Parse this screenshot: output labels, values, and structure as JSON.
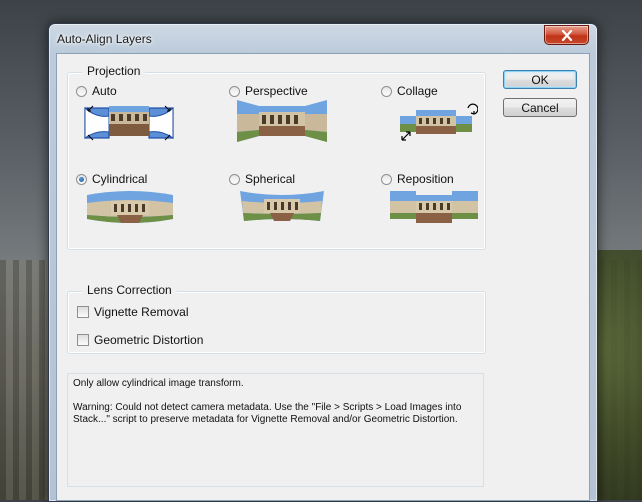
{
  "window": {
    "title": "Auto-Align Layers"
  },
  "projection": {
    "legend": "Projection",
    "options": [
      {
        "label": "Auto",
        "checked": false
      },
      {
        "label": "Perspective",
        "checked": false
      },
      {
        "label": "Collage",
        "checked": false
      },
      {
        "label": "Cylindrical",
        "checked": true
      },
      {
        "label": "Spherical",
        "checked": false
      },
      {
        "label": "Reposition",
        "checked": false
      }
    ]
  },
  "lens_correction": {
    "legend": "Lens Correction",
    "options": [
      {
        "label": "Vignette Removal",
        "checked": false
      },
      {
        "label": "Geometric Distortion",
        "checked": false
      }
    ]
  },
  "buttons": {
    "ok": "OK",
    "cancel": "Cancel"
  },
  "info": {
    "line1": "Only allow cylindrical image transform.",
    "line2": "Warning: Could not detect camera metadata. Use the \"File > Scripts > Load Images into Stack...\" script to preserve metadata for Vignette Removal and/or Geometric Distortion."
  },
  "colors": {
    "selection_blue": "#2a62b8",
    "close_red": "#c9472b"
  }
}
